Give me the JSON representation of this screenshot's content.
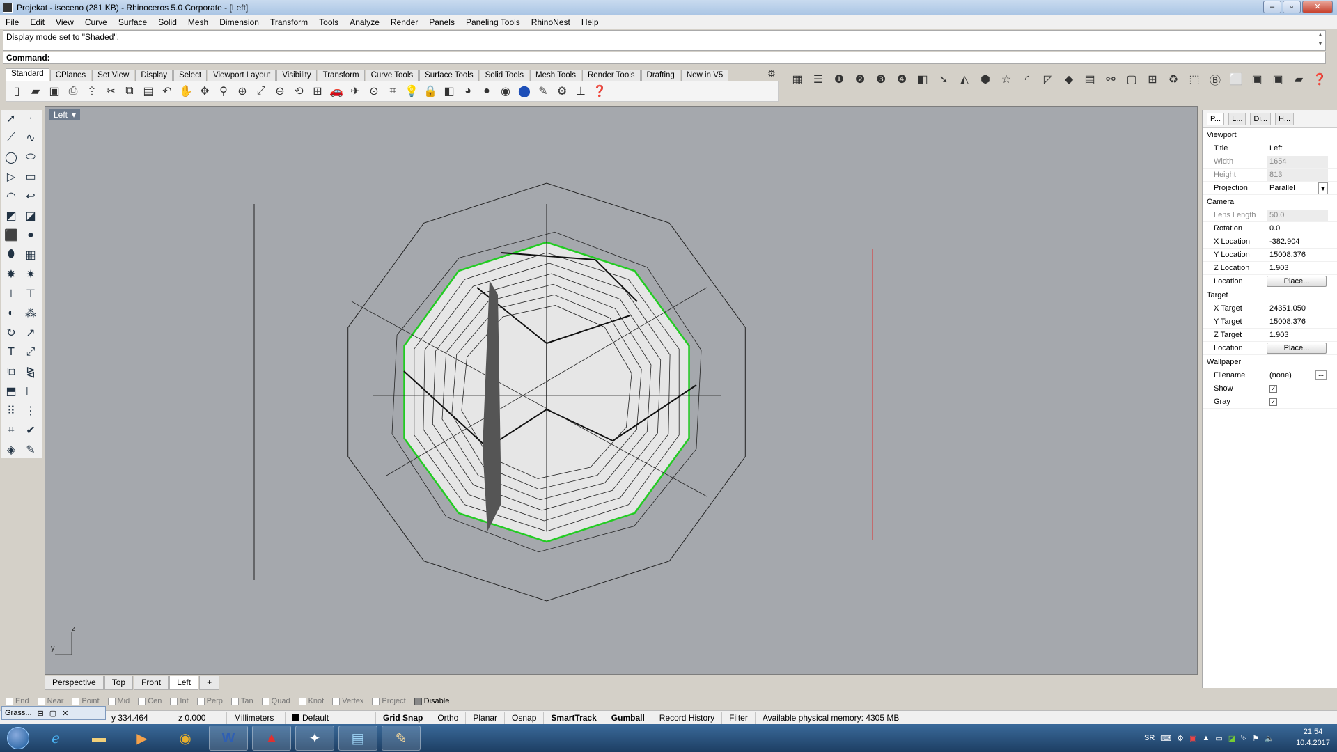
{
  "window": {
    "title": "Projekat - iseceno (281 KB) - Rhinoceros  5.0 Corporate - [Left]"
  },
  "menu": [
    "File",
    "Edit",
    "View",
    "Curve",
    "Surface",
    "Solid",
    "Mesh",
    "Dimension",
    "Transform",
    "Tools",
    "Analyze",
    "Render",
    "Panels",
    "Paneling Tools",
    "RhinoNest",
    "Help"
  ],
  "command": {
    "history": "Display mode set to \"Shaded\".",
    "prompt": "Command:"
  },
  "toolbar_tabs": [
    "Standard",
    "CPlanes",
    "Set View",
    "Display",
    "Select",
    "Viewport Layout",
    "Visibility",
    "Transform",
    "Curve Tools",
    "Surface Tools",
    "Solid Tools",
    "Mesh Tools",
    "Render Tools",
    "Drafting",
    "New in V5"
  ],
  "toolbar_icons": [
    "new-file-icon",
    "open-icon",
    "save-icon",
    "print-icon",
    "import-icon",
    "cut-icon",
    "copy-icon",
    "paste-icon",
    "undo-icon",
    "pan-hand-icon",
    "move-view-icon",
    "zoom-icon",
    "zoom-window-icon",
    "zoom-extents-icon",
    "zoom-selected-icon",
    "rotate-view-icon",
    "four-views-icon",
    "car-icon",
    "plane-icon",
    "point-icon",
    "grid-snap-icon",
    "light-bulb-icon",
    "lock-icon",
    "layer-icon",
    "material-icon",
    "sphere-shaded-icon",
    "sphere-rendered-icon",
    "sphere-blue-icon",
    "pencil-icon",
    "gear-icon",
    "cplane-icon",
    "help-icon"
  ],
  "viewport": {
    "label": "Left",
    "axis_z": "z",
    "axis_y": "y"
  },
  "viewport_tabs": [
    "Perspective",
    "Top",
    "Front",
    "Left"
  ],
  "osnaps": [
    {
      "label": "End",
      "checked": false
    },
    {
      "label": "Near",
      "checked": false
    },
    {
      "label": "Point",
      "checked": false
    },
    {
      "label": "Mid",
      "checked": false
    },
    {
      "label": "Cen",
      "checked": false
    },
    {
      "label": "Int",
      "checked": false
    },
    {
      "label": "Perp",
      "checked": false
    },
    {
      "label": "Tan",
      "checked": false
    },
    {
      "label": "Quad",
      "checked": false
    },
    {
      "label": "Knot",
      "checked": false
    },
    {
      "label": "Vertex",
      "checked": false
    },
    {
      "label": "Project",
      "checked": false
    },
    {
      "label": "Disable",
      "checked": true
    }
  ],
  "status": {
    "floating_win": "Grass...",
    "y": "y 334.464",
    "z": "z 0.000",
    "units": "Millimeters",
    "layer": "Default",
    "grid_snap": "Grid Snap",
    "ortho": "Ortho",
    "planar": "Planar",
    "osnap": "Osnap",
    "smarttrack": "SmartTrack",
    "gumball": "Gumball",
    "record_history": "Record History",
    "filter": "Filter",
    "memory": "Available physical memory: 4305 MB"
  },
  "panel": {
    "tabs": [
      "P...",
      "L...",
      "Di...",
      "H..."
    ],
    "viewport_section": "Viewport",
    "camera_section": "Camera",
    "target_section": "Target",
    "wallpaper_section": "Wallpaper",
    "rows": {
      "title": {
        "name": "Title",
        "value": "Left"
      },
      "width": {
        "name": "Width",
        "value": "1654"
      },
      "height": {
        "name": "Height",
        "value": "813"
      },
      "projection": {
        "name": "Projection",
        "value": "Parallel"
      },
      "lens": {
        "name": "Lens Length",
        "value": "50.0"
      },
      "rotation": {
        "name": "Rotation",
        "value": "0.0"
      },
      "xloc": {
        "name": "X Location",
        "value": "-382.904"
      },
      "yloc": {
        "name": "Y Location",
        "value": "15008.376"
      },
      "zloc": {
        "name": "Z Location",
        "value": "1.903"
      },
      "loc": {
        "name": "Location",
        "value": "Place..."
      },
      "xtarget": {
        "name": "X Target",
        "value": "24351.050"
      },
      "ytarget": {
        "name": "Y Target",
        "value": "15008.376"
      },
      "ztarget": {
        "name": "Z Target",
        "value": "1.903"
      },
      "tloc": {
        "name": "Location",
        "value": "Place..."
      },
      "filename": {
        "name": "Filename",
        "value": "(none)"
      },
      "show": {
        "name": "Show",
        "checked": true
      },
      "gray": {
        "name": "Gray",
        "checked": true
      }
    }
  },
  "taskbar": {
    "lang": "SR",
    "time": "21:54",
    "date": "10.4.2017"
  },
  "colors": {
    "viewport_bg": "#a5a8ad",
    "selection_green": "#3cc83c",
    "axis_red": "#e03030"
  }
}
